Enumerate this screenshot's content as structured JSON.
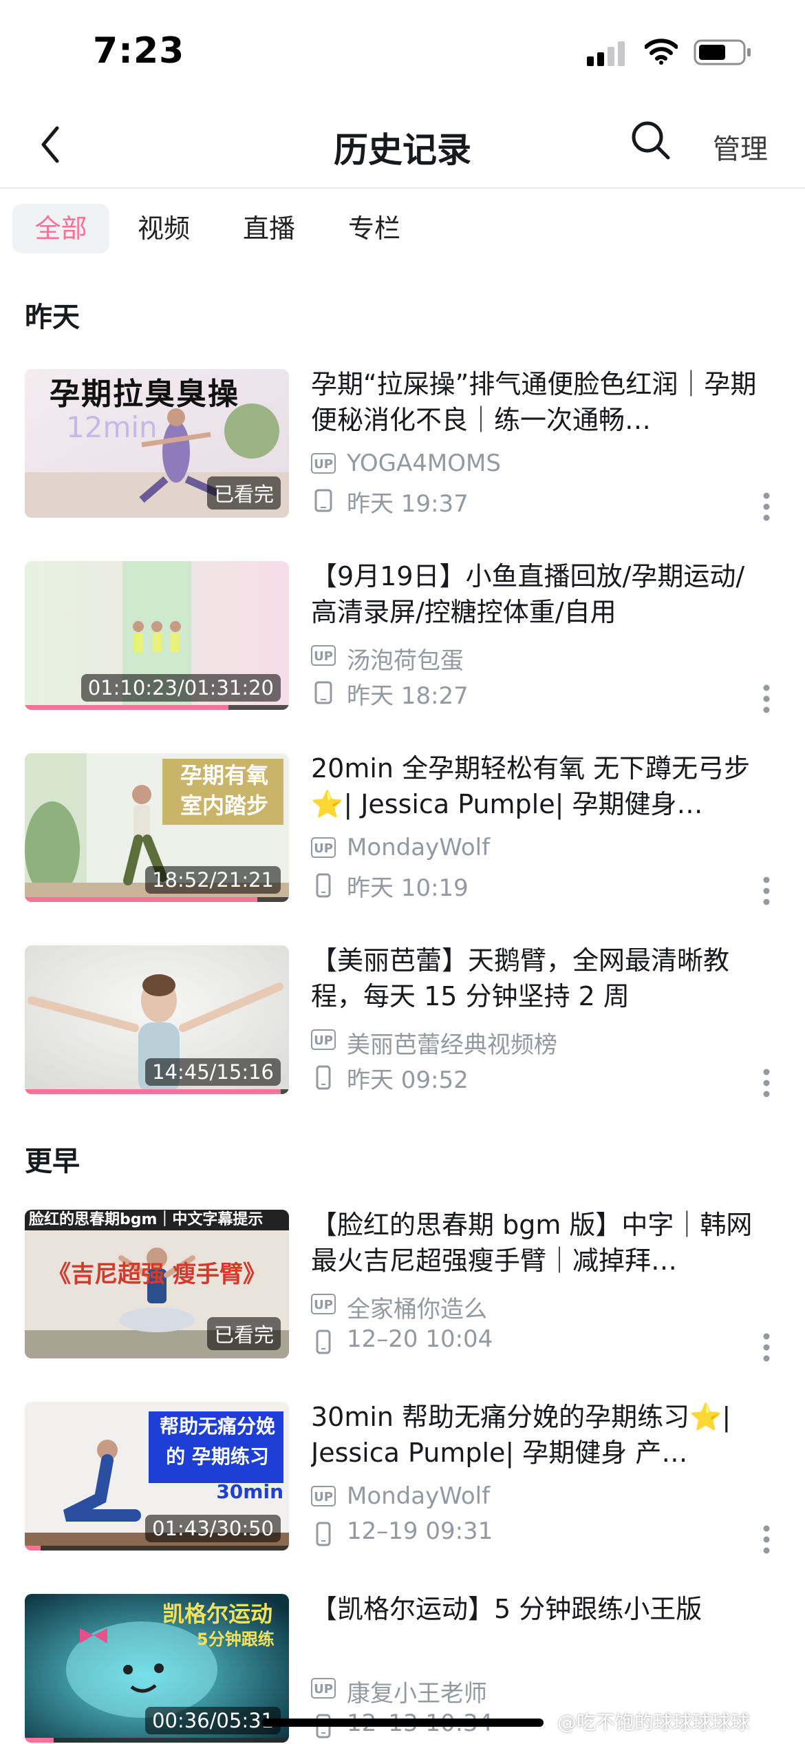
{
  "status_bar": {
    "time": "7:23"
  },
  "nav": {
    "title": "历史记录",
    "manage_label": "管理"
  },
  "tabs": [
    {
      "label": "全部",
      "active": true
    },
    {
      "label": "视频",
      "active": false
    },
    {
      "label": "直播",
      "active": false
    },
    {
      "label": "专栏",
      "active": false
    }
  ],
  "sections": [
    {
      "title": "昨天"
    },
    {
      "title": "更早"
    }
  ],
  "items": [
    {
      "title": "孕期“拉屎操”排气通便脸色红润｜孕期便秘消化不良｜练一次通畅…",
      "thumb_text": "孕期拉臭臭操",
      "thumb_sub": "12min",
      "badge": "已看完",
      "progress": 0,
      "up_label": "UP",
      "uploader": "YOGA4MOMS",
      "time": "昨天 19:37",
      "device": "pad"
    },
    {
      "title": "【9月19日】小鱼直播回放/孕期运动/高清录屏/控糖控体重/自用",
      "thumb_text": "",
      "thumb_sub": "",
      "badge": "01:10:23/01:31:20",
      "progress": 0.77,
      "up_label": "UP",
      "uploader": "汤泡荷包蛋",
      "time": "昨天 18:27",
      "device": "pad"
    },
    {
      "title": "20min 全孕期轻松有氧 无下蹲无弓步⭐| Jessica Pumple| 孕期健身…",
      "thumb_text": "孕期有氧 室内踏步",
      "thumb_sub": "",
      "badge": "18:52/21:21",
      "progress": 0.88,
      "up_label": "UP",
      "uploader": "MondayWolf",
      "time": "昨天 10:19",
      "device": "phone"
    },
    {
      "title": "【美丽芭蕾】天鹅臂，全网最清晰教程，每天 15 分钟坚持 2 周",
      "thumb_text": "",
      "thumb_sub": "",
      "badge": "14:45/15:16",
      "progress": 0.97,
      "up_label": "UP",
      "uploader": "美丽芭蕾经典视频榜",
      "time": "昨天 09:52",
      "device": "phone"
    },
    {
      "title": "【脸红的思春期 bgm 版】中字｜韩网最火吉尼超强瘦手臂｜减掉拜…",
      "thumb_text": "《吉尼超强 瘦手臂》",
      "thumb_sub": "脸红的思春期bgm｜中文字幕提示",
      "badge": "已看完",
      "progress": 0,
      "up_label": "UP",
      "uploader": "全家桶你造么",
      "time": "12–20 10:04",
      "device": "phone"
    },
    {
      "title": "30min 帮助无痛分娩的孕期练习⭐| Jessica Pumple| 孕期健身 产…",
      "thumb_text": "帮助无痛分娩的 孕期练习",
      "thumb_sub": "30min",
      "badge": "01:43/30:50",
      "progress": 0.06,
      "up_label": "UP",
      "uploader": "MondayWolf",
      "time": "12–19 09:31",
      "device": "phone"
    },
    {
      "title": "【凯格尔运动】5 分钟跟练小王版",
      "thumb_text": "凯格尔运动",
      "thumb_sub": "5分钟跟练",
      "badge": "00:36/05:31",
      "progress": 0.11,
      "up_label": "UP",
      "uploader": "康复小王老师",
      "time": "12–13 10:34",
      "device": "phone"
    }
  ],
  "watermark": "@吃不饱的球球球球球",
  "colors": {
    "accent": "#fb7299",
    "secondary_text": "#9499a0",
    "tab_bg": "#f1f2f3"
  }
}
